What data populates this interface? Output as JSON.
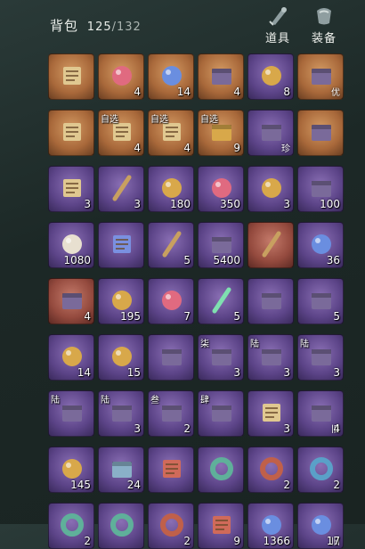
{
  "header": {
    "title": "背包",
    "used": "125",
    "separator": "/",
    "capacity": "132",
    "tabs": [
      {
        "label": "道具",
        "icon": "scroll-icon"
      },
      {
        "label": "装备",
        "icon": "armor-icon"
      }
    ]
  },
  "colors": {
    "orange": "#a8683a",
    "purple": "#5c4488",
    "blue": "#3b5986",
    "green": "#3f7256",
    "red": "#944a3e"
  },
  "items": [
    {
      "r": "orange",
      "icon": "scroll-chest-icon",
      "qty": "",
      "tag": "",
      "tr": "",
      "bl": ""
    },
    {
      "r": "orange",
      "icon": "pink-orb-icon",
      "qty": "4",
      "tag": "",
      "tr": "",
      "bl": ""
    },
    {
      "r": "orange",
      "icon": "blue-orb-icon",
      "qty": "14",
      "tag": "",
      "tr": "",
      "bl": ""
    },
    {
      "r": "orange",
      "icon": "blue-gem-icon",
      "qty": "4",
      "tag": "",
      "tr": "",
      "bl": ""
    },
    {
      "r": "purple",
      "icon": "gold-egg-icon",
      "qty": "8",
      "tag": "",
      "tr": "",
      "bl": ""
    },
    {
      "r": "orange",
      "icon": "treasure-box-icon",
      "qty": "",
      "tag": "",
      "tr": "",
      "bl": "优"
    },
    {
      "r": "orange",
      "icon": "map-scroll-icon",
      "qty": "",
      "tag": "",
      "tr": "",
      "bl": ""
    },
    {
      "r": "orange",
      "icon": "map-scroll-icon",
      "qty": "4",
      "tag": "自选",
      "tr": "",
      "bl": ""
    },
    {
      "r": "orange",
      "icon": "map-scroll-icon",
      "qty": "4",
      "tag": "自选",
      "tr": "",
      "bl": ""
    },
    {
      "r": "orange",
      "icon": "gold-box-icon",
      "qty": "9",
      "tag": "自选",
      "tr": "",
      "bl": ""
    },
    {
      "r": "purple",
      "icon": "ore-icon",
      "qty": "",
      "tag": "",
      "tr": "",
      "bl": "珍"
    },
    {
      "r": "orange",
      "icon": "bag-icon",
      "qty": "",
      "tag": "",
      "tr": "",
      "bl": ""
    },
    {
      "r": "purple",
      "icon": "scroll-icon",
      "qty": "3",
      "tag": "",
      "tr": "",
      "bl": ""
    },
    {
      "r": "purple",
      "icon": "brush-icon",
      "qty": "3",
      "tag": "",
      "tr": "",
      "bl": ""
    },
    {
      "r": "purple",
      "icon": "coin-icon",
      "qty": "180",
      "tag": "",
      "tr": "",
      "bl": ""
    },
    {
      "r": "purple",
      "icon": "pink-coin-icon",
      "qty": "350",
      "tag": "",
      "tr": "",
      "bl": ""
    },
    {
      "r": "purple",
      "icon": "pearl-icon",
      "qty": "3",
      "tag": "",
      "tr": "",
      "bl": ""
    },
    {
      "r": "purple",
      "icon": "moon-icon",
      "qty": "100",
      "tag": "",
      "tr": "",
      "bl": ""
    },
    {
      "r": "purple",
      "icon": "panda-icon",
      "qty": "1080",
      "tag": "",
      "tr": "",
      "bl": ""
    },
    {
      "r": "purple",
      "icon": "ticket-icon",
      "qty": "",
      "tag": "",
      "tr": "",
      "bl": ""
    },
    {
      "r": "purple",
      "icon": "token-icon",
      "qty": "5",
      "tag": "",
      "tr": "",
      "bl": ""
    },
    {
      "r": "purple",
      "icon": "flower-icon",
      "qty": "5400",
      "tag": "",
      "tr": "",
      "bl": ""
    },
    {
      "r": "red",
      "icon": "shovel-icon",
      "qty": "",
      "tag": "",
      "tr": "",
      "bl": ""
    },
    {
      "r": "purple",
      "icon": "eye-orb-icon",
      "qty": "36",
      "tag": "",
      "tr": "",
      "bl": ""
    },
    {
      "r": "red",
      "icon": "rice-icon",
      "qty": "4",
      "tag": "",
      "tr": "",
      "bl": ""
    },
    {
      "r": "purple",
      "icon": "glow-orb-icon",
      "qty": "195",
      "tag": "",
      "tr": "",
      "bl": ""
    },
    {
      "r": "purple",
      "icon": "slime-icon",
      "qty": "7",
      "tag": "",
      "tr": "",
      "bl": ""
    },
    {
      "r": "purple",
      "icon": "jade-stick-icon",
      "qty": "5",
      "tag": "",
      "tr": "",
      "bl": ""
    },
    {
      "r": "purple",
      "icon": "bundle-icon",
      "qty": "",
      "tag": "",
      "tr": "",
      "bl": ""
    },
    {
      "r": "purple",
      "icon": "badge-icon",
      "qty": "5",
      "tag": "",
      "tr": "",
      "bl": ""
    },
    {
      "r": "purple",
      "icon": "dumpling-icon",
      "qty": "14",
      "tag": "",
      "tr": "",
      "bl": ""
    },
    {
      "r": "purple",
      "icon": "dumpling-icon",
      "qty": "15",
      "tag": "",
      "tr": "",
      "bl": ""
    },
    {
      "r": "purple",
      "icon": "fan-icon",
      "qty": "",
      "tag": "",
      "tr": "",
      "bl": ""
    },
    {
      "r": "purple",
      "icon": "chest-icon",
      "qty": "3",
      "tag": "柒",
      "tr": "",
      "bl": ""
    },
    {
      "r": "purple",
      "icon": "chest-icon",
      "qty": "3",
      "tag": "陆",
      "tr": "",
      "bl": ""
    },
    {
      "r": "purple",
      "icon": "chest-icon",
      "qty": "3",
      "tag": "陆",
      "tr": "",
      "bl": ""
    },
    {
      "r": "purple",
      "icon": "chest-icon",
      "qty": "",
      "tag": "陆",
      "tr": "",
      "bl": ""
    },
    {
      "r": "purple",
      "icon": "chest-icon",
      "qty": "3",
      "tag": "陆",
      "tr": "",
      "bl": ""
    },
    {
      "r": "purple",
      "icon": "chest-icon",
      "qty": "2",
      "tag": "叁",
      "tr": "",
      "bl": ""
    },
    {
      "r": "purple",
      "icon": "chest-icon",
      "qty": "",
      "tag": "肆",
      "tr": "",
      "bl": ""
    },
    {
      "r": "purple",
      "icon": "cards-icon",
      "qty": "3",
      "tag": "",
      "tr": "",
      "bl": ""
    },
    {
      "r": "purple",
      "icon": "lantern-icon",
      "qty": "4",
      "tag": "",
      "tr": "",
      "bl": "旧"
    },
    {
      "r": "purple",
      "icon": "coin-icon",
      "qty": "145",
      "tag": "",
      "tr": "",
      "bl": ""
    },
    {
      "r": "purple",
      "icon": "crystal-icon",
      "qty": "24",
      "tag": "",
      "tr": "",
      "bl": ""
    },
    {
      "r": "purple",
      "icon": "red-ticket-icon",
      "qty": "",
      "tag": "",
      "tr": "",
      "bl": ""
    },
    {
      "r": "purple",
      "icon": "jade-ring-icon",
      "qty": "",
      "tag": "",
      "tr": "",
      "bl": ""
    },
    {
      "r": "purple",
      "icon": "red-ring-icon",
      "qty": "2",
      "tag": "",
      "tr": "",
      "bl": ""
    },
    {
      "r": "purple",
      "icon": "blue-ring-icon",
      "qty": "2",
      "tag": "",
      "tr": "",
      "bl": ""
    },
    {
      "r": "purple",
      "icon": "jade-ring-icon",
      "qty": "2",
      "tag": "",
      "tr": "",
      "bl": ""
    },
    {
      "r": "purple",
      "icon": "jade-ring-icon",
      "qty": "",
      "tag": "",
      "tr": "",
      "bl": ""
    },
    {
      "r": "purple",
      "icon": "red-ring-icon",
      "qty": "2",
      "tag": "",
      "tr": "",
      "bl": ""
    },
    {
      "r": "purple",
      "icon": "talisman-icon",
      "qty": "9",
      "tag": "",
      "tr": "",
      "bl": ""
    },
    {
      "r": "purple",
      "icon": "eye-orb-icon",
      "qty": "1366",
      "tag": "",
      "tr": "",
      "bl": ""
    },
    {
      "r": "purple",
      "icon": "eye-orb-icon",
      "qty": "17",
      "tag": "",
      "tr": "",
      "bl": "旧"
    }
  ]
}
